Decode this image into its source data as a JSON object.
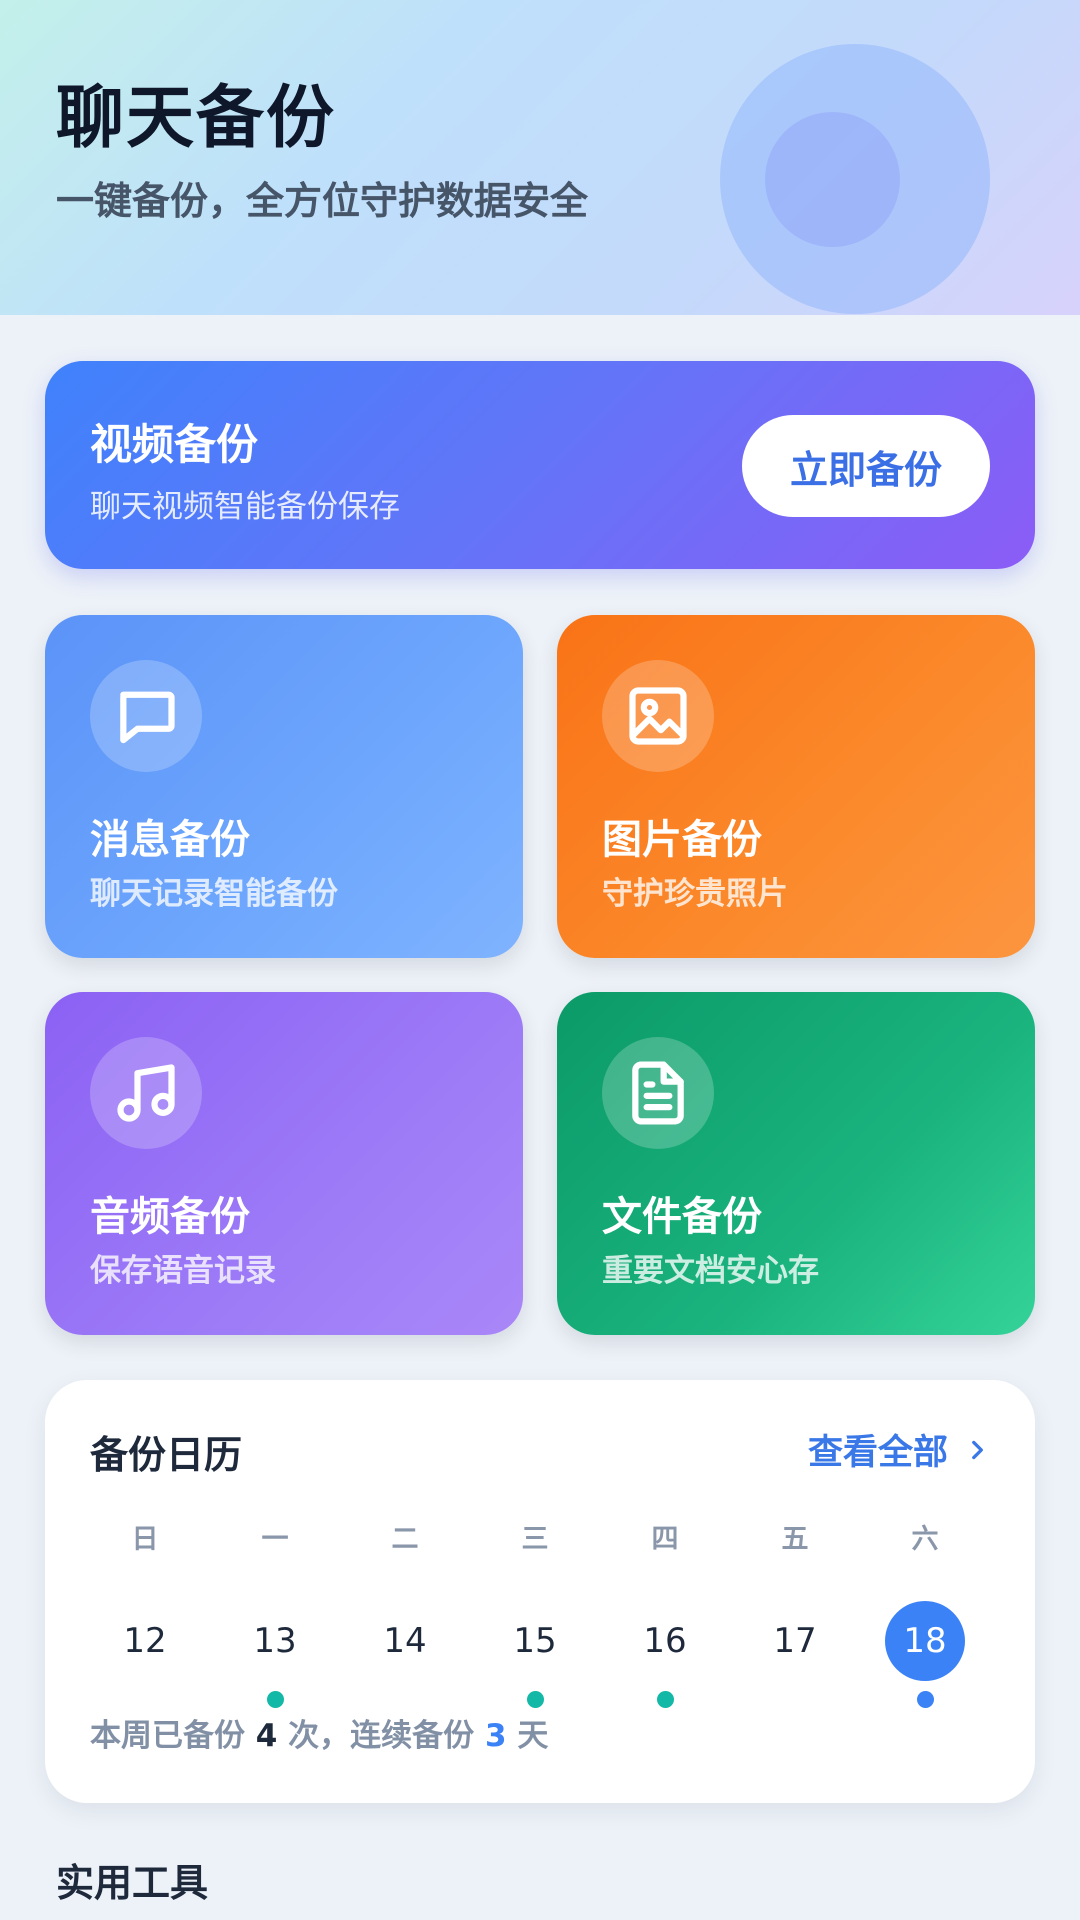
{
  "header": {
    "title": "聊天备份",
    "subtitle": "一键备份，全方位守护数据安全"
  },
  "video_backup": {
    "title": "视频备份",
    "subtitle": "聊天视频智能备份保存",
    "button_label": "立即备份"
  },
  "features": [
    {
      "title": "消息备份",
      "subtitle": "聊天记录智能备份",
      "icon": "chat-bubble-icon"
    },
    {
      "title": "图片备份",
      "subtitle": "守护珍贵照片",
      "icon": "image-icon"
    },
    {
      "title": "音频备份",
      "subtitle": "保存语音记录",
      "icon": "music-note-icon"
    },
    {
      "title": "文件备份",
      "subtitle": "重要文档安心存",
      "icon": "document-icon"
    }
  ],
  "calendar": {
    "title": "备份日历",
    "view_all": "查看全部",
    "days": [
      {
        "name": "日",
        "date": "12",
        "backed_up": false,
        "selected": false
      },
      {
        "name": "一",
        "date": "13",
        "backed_up": true,
        "selected": false
      },
      {
        "name": "二",
        "date": "14",
        "backed_up": false,
        "selected": false
      },
      {
        "name": "三",
        "date": "15",
        "backed_up": true,
        "selected": false
      },
      {
        "name": "四",
        "date": "16",
        "backed_up": true,
        "selected": false
      },
      {
        "name": "五",
        "date": "17",
        "backed_up": false,
        "selected": false
      },
      {
        "name": "六",
        "date": "18",
        "backed_up": true,
        "selected": true
      }
    ],
    "summary": {
      "prefix": "本周已备份",
      "count": "4",
      "middle": "次，连续备份",
      "streak": "3",
      "suffix": "天"
    },
    "colors": {
      "dot_done": "#14b8a6",
      "dot_today": "#3b82f6",
      "selected": "#3b82f6"
    }
  },
  "tools_section": {
    "title": "实用工具"
  },
  "colors": {
    "accent": "#3b82f6",
    "message_card": "#5b93f8",
    "image_card": "#f97316",
    "audio_card": "#8b61f4",
    "file_card": "#10b981"
  }
}
